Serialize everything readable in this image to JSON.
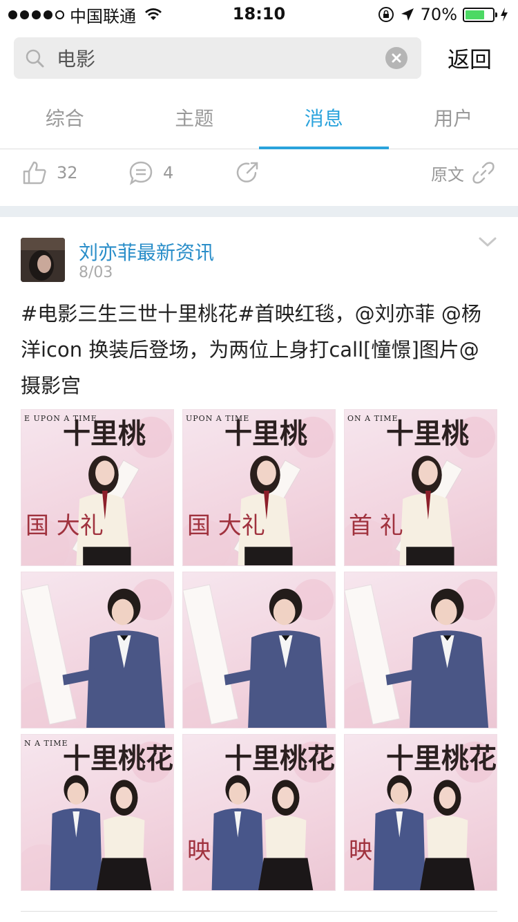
{
  "status_bar": {
    "carrier": "中国联通",
    "time": "18:10",
    "battery_pct": "70%",
    "battery_level": 0.7
  },
  "search": {
    "value": "电影",
    "back_label": "返回"
  },
  "tabs": [
    {
      "label": "综合",
      "active": false
    },
    {
      "label": "主题",
      "active": false
    },
    {
      "label": "消息",
      "active": true
    },
    {
      "label": "用户",
      "active": false
    }
  ],
  "prev_actions": {
    "likes": "32",
    "comments": "4",
    "origin_label": "原文"
  },
  "post": {
    "author": "刘亦菲最新资讯",
    "date": "8/03",
    "text": "#电影三生三世十里桃花#首映红毯，@刘亦菲 @杨洋icon 换装后登场，为两位上身打call[憧憬]图片@摄影宫"
  },
  "photos": [
    {
      "caption": "E UPON A TIME",
      "big": "十里桃",
      "red": "国 大礼"
    },
    {
      "caption": "UPON A TIME",
      "big": "十里桃",
      "red": "国 大礼"
    },
    {
      "caption": "ON A TIME",
      "big": "十里桃",
      "red": "首 礼"
    },
    {
      "caption": "",
      "big": "",
      "red": ""
    },
    {
      "caption": "",
      "big": "",
      "red": ""
    },
    {
      "caption": "",
      "big": "",
      "red": ""
    },
    {
      "caption": "N A TIME",
      "big": "十里桃花",
      "red": ""
    },
    {
      "caption": "",
      "big": "十里桃花",
      "red": "映"
    },
    {
      "caption": "",
      "big": "十里桃花",
      "red": "映"
    }
  ],
  "colors": {
    "accent": "#2aa3dc",
    "link": "#2a8ec9",
    "battery": "#4cd964"
  }
}
